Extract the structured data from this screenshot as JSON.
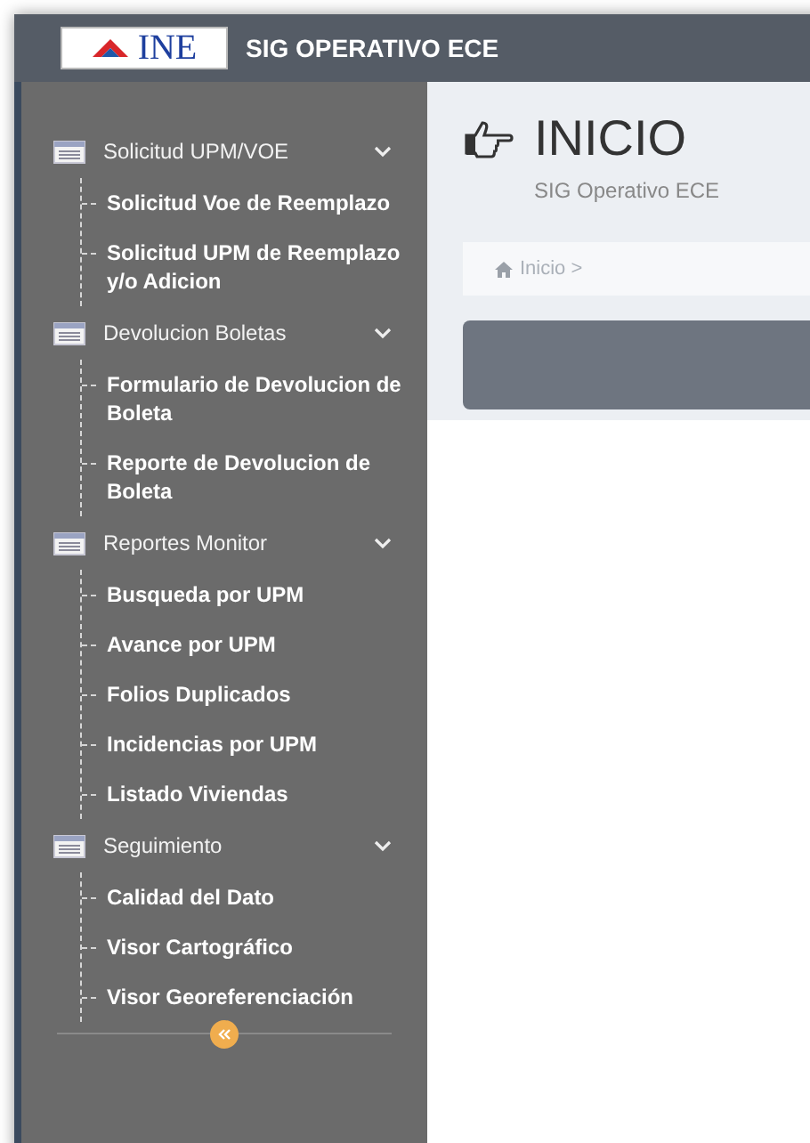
{
  "header": {
    "logo_text": "INE",
    "title": "SIG OPERATIVO ECE"
  },
  "sidebar": {
    "groups": [
      {
        "label": "Solicitud UPM/VOE",
        "expanded": true,
        "children": [
          "Solicitud Voe de Reemplazo",
          "Solicitud UPM de Reemplazo y/o Adicion"
        ]
      },
      {
        "label": "Devolucion Boletas",
        "expanded": true,
        "children": [
          "Formulario de Devolucion de Boleta",
          "Reporte de Devolucion de Boleta"
        ]
      },
      {
        "label": "Reportes Monitor",
        "expanded": true,
        "children": [
          "Busqueda por UPM",
          "Avance por UPM",
          "Folios Duplicados",
          "Incidencias por UPM",
          "Listado Viviendas"
        ]
      },
      {
        "label": "Seguimiento",
        "expanded": true,
        "children": [
          "Calidad del Dato",
          "Visor Cartográfico",
          "Visor Georeferenciación"
        ]
      }
    ]
  },
  "page": {
    "title": "INICIO",
    "subtitle": "SIG Operativo ECE",
    "breadcrumb": "Inicio >"
  }
}
